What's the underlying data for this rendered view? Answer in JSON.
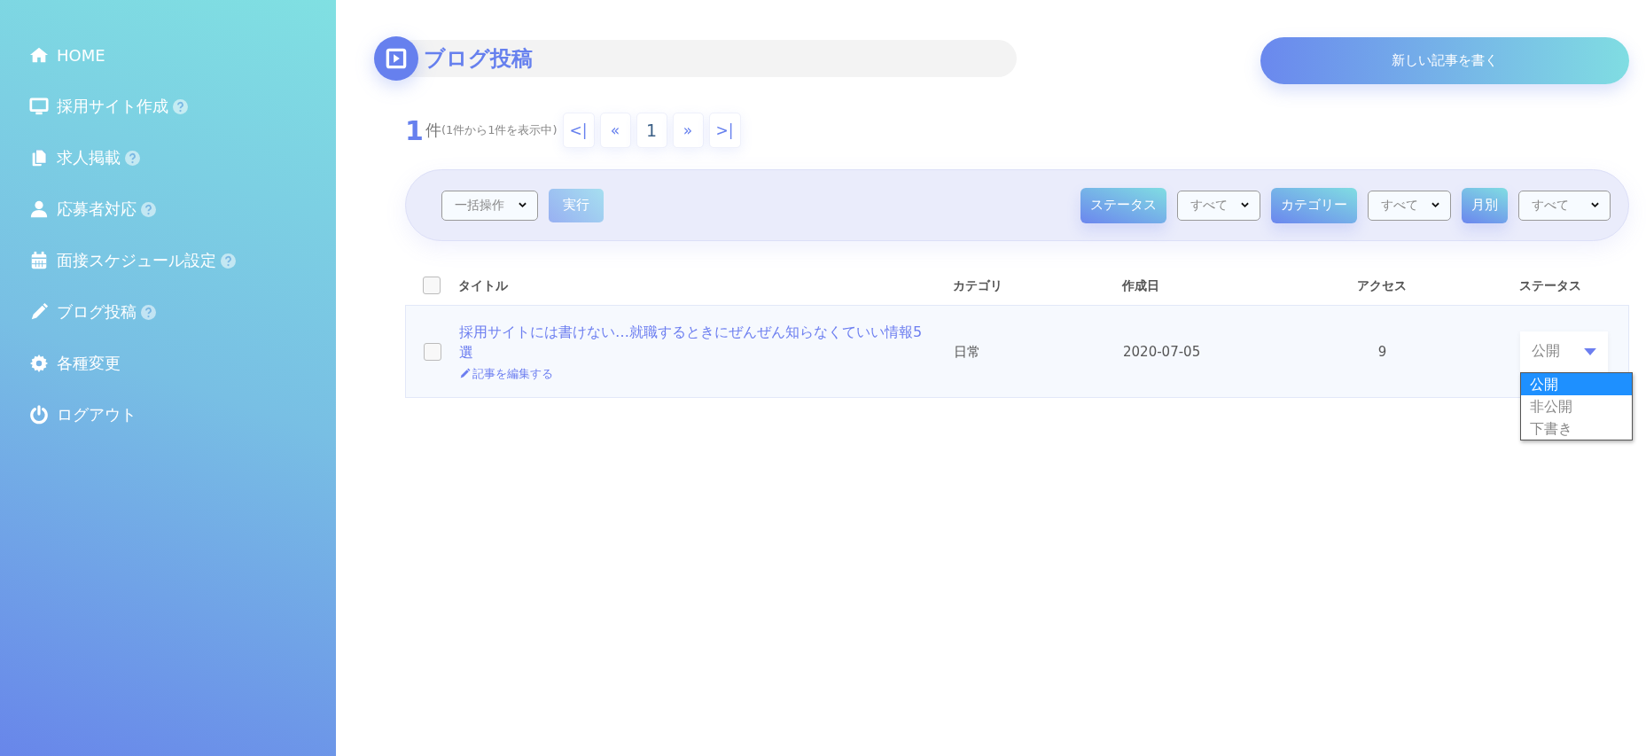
{
  "sidebar": {
    "items": [
      {
        "label": "HOME",
        "help": false
      },
      {
        "label": "採用サイト作成",
        "help": true
      },
      {
        "label": "求人掲載",
        "help": true
      },
      {
        "label": "応募者対応",
        "help": true
      },
      {
        "label": "面接スケジュール設定",
        "help": true
      },
      {
        "label": "ブログ投稿",
        "help": true
      },
      {
        "label": "各種変更",
        "help": false
      },
      {
        "label": "ログアウト",
        "help": false
      }
    ]
  },
  "header": {
    "title": "ブログ投稿",
    "new_button": "新しい記事を書く"
  },
  "pagination": {
    "count": "1",
    "unit": "件",
    "summary": "(1件から1件を表示中)",
    "pages": [
      "<|",
      "«",
      "1",
      "»",
      ">|"
    ]
  },
  "filter_bar": {
    "bulk_select": "一括操作",
    "run_button": "実行",
    "filters": [
      {
        "label": "ステータス",
        "value": "すべて"
      },
      {
        "label": "カテゴリー",
        "value": "すべて"
      },
      {
        "label": "月別",
        "value": "すべて"
      }
    ]
  },
  "table": {
    "select_all_checked": false,
    "columns": [
      "タイトル",
      "カテゴリ",
      "作成日",
      "アクセス",
      "ステータス"
    ],
    "rows": [
      {
        "checked": false,
        "title": "採用サイトには書けない…就職するときにぜんぜん知らなくていい情報5選",
        "edit_link": "記事を編集する",
        "category": "日常",
        "date": "2020-07-05",
        "access": "9",
        "status": "公開",
        "expanded": true,
        "status_options": [
          {
            "label": "公開",
            "selected": true
          },
          {
            "label": "非公開",
            "selected": false
          },
          {
            "label": "下書き",
            "selected": false
          }
        ]
      }
    ]
  }
}
